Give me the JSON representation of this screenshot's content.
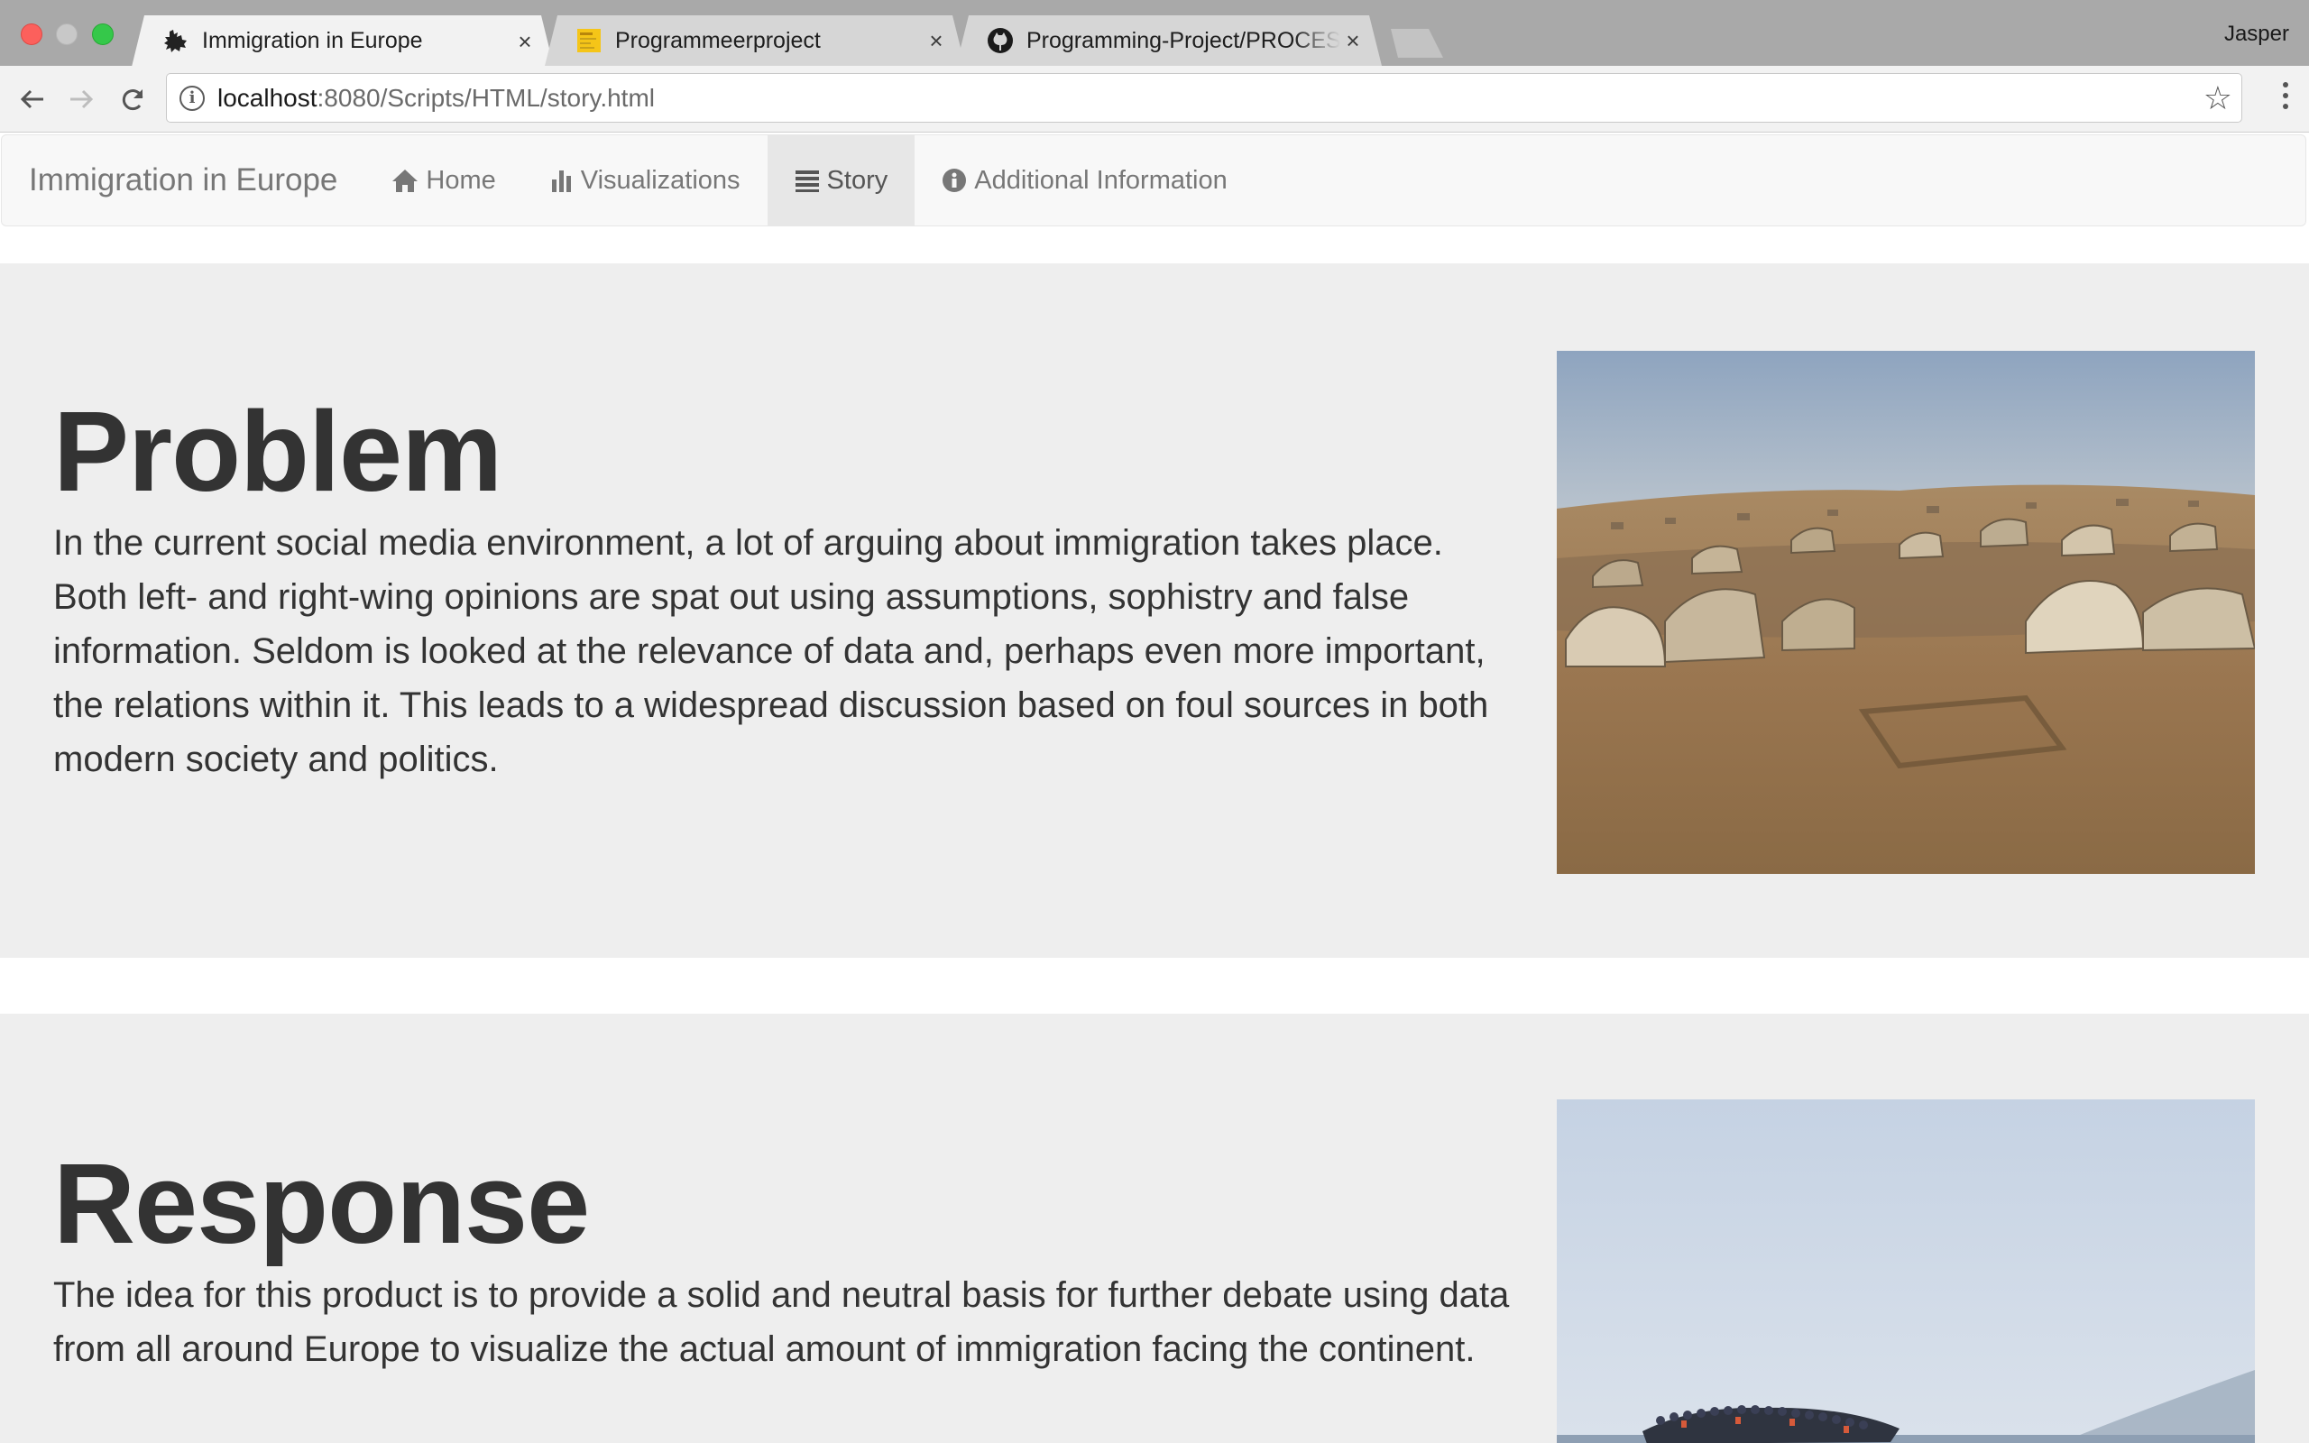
{
  "browser": {
    "tabs": [
      {
        "title": "Immigration in Europe",
        "favicon": "europe-map-icon",
        "active": true
      },
      {
        "title": "Programmeerproject",
        "favicon": "yellow-doc-icon",
        "active": false
      },
      {
        "title": "Programming-Project/PROCESS.md",
        "favicon": "github-icon",
        "active": false
      }
    ],
    "close_glyph": "×",
    "profile_name": "Jasper",
    "url_host": "localhost",
    "url_path": ":8080/Scripts/HTML/story.html"
  },
  "navbar": {
    "brand": "Immigration in Europe",
    "items": [
      {
        "label": "Home",
        "icon": "home-icon",
        "active": false
      },
      {
        "label": "Visualizations",
        "icon": "bar-chart-icon",
        "active": false
      },
      {
        "label": "Story",
        "icon": "list-icon",
        "active": true
      },
      {
        "label": "Additional Information",
        "icon": "info-circle-icon",
        "active": false
      }
    ]
  },
  "sections": [
    {
      "title": "Problem",
      "text": "In the current social media environment, a lot of arguing about immigration takes place. Both left- and right-wing opinions are spat out using assumptions, sophistry and false information. Seldom is looked at the relevance of data and, perhaps even more important, the relations within it. This leads to a widespread discussion based on foul sources in both modern society and politics.",
      "image": "refugee-camp-photo"
    },
    {
      "title": "Response",
      "text": "The idea for this product is to provide a solid and neutral basis for further debate using data from all around Europe to visualize the actual amount of immigration facing the continent.",
      "image": "migrant-boat-photo"
    }
  ],
  "colors": {
    "jumbotron_bg": "#eeeeee",
    "navbar_bg": "#f8f8f8",
    "navbar_active_bg": "#e7e7e7",
    "heading": "#333333"
  }
}
